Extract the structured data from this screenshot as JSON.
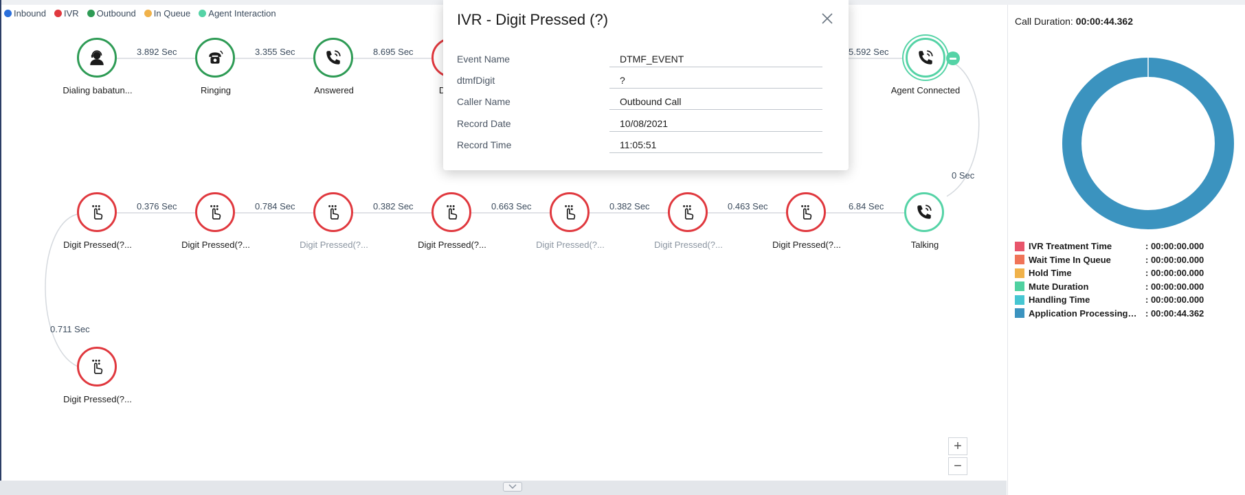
{
  "legend": [
    {
      "label": "Inbound",
      "color": "#2a6fdb"
    },
    {
      "label": "IVR",
      "color": "#e0383e"
    },
    {
      "label": "Outbound",
      "color": "#2e9b55"
    },
    {
      "label": "In Queue",
      "color": "#f0b24a"
    },
    {
      "label": "Agent Interaction",
      "color": "#55d3a6"
    }
  ],
  "flow": {
    "nodes": [
      {
        "label": "Dialing babatun...",
        "icon": "agent-headset-icon",
        "color": "green"
      },
      {
        "label": "Ringing",
        "icon": "ringing-phone-icon",
        "color": "green"
      },
      {
        "label": "Answered",
        "icon": "phone-call-icon",
        "color": "green"
      },
      {
        "label": "Digit P",
        "icon": "digit-pressed-icon",
        "color": "red"
      },
      {
        "label": "Agent Connected",
        "icon": "phone-call-icon",
        "color": "teal"
      },
      {
        "label": "Digit Pressed(?...",
        "icon": "digit-pressed-icon",
        "color": "red"
      },
      {
        "label": "Digit Pressed(?...",
        "icon": "digit-pressed-icon",
        "color": "red"
      },
      {
        "label": "Digit Pressed(?...",
        "icon": "digit-pressed-icon",
        "color": "red",
        "muted": true
      },
      {
        "label": "Digit Pressed(?...",
        "icon": "digit-pressed-icon",
        "color": "red"
      },
      {
        "label": "Digit Pressed(?...",
        "icon": "digit-pressed-icon",
        "color": "red",
        "muted": true
      },
      {
        "label": "Digit Pressed(?...",
        "icon": "digit-pressed-icon",
        "color": "red",
        "muted": true
      },
      {
        "label": "Digit Pressed(?...",
        "icon": "digit-pressed-icon",
        "color": "red"
      },
      {
        "label": "Talking",
        "icon": "phone-call-icon",
        "color": "teal"
      },
      {
        "label": "Digit Pressed(?...",
        "icon": "digit-pressed-icon",
        "color": "red"
      }
    ],
    "durations": [
      "3.892 Sec",
      "3.355 Sec",
      "8.695 Sec",
      "5.592 Sec",
      "0 Sec",
      "0.376 Sec",
      "0.784 Sec",
      "0.382 Sec",
      "0.663 Sec",
      "0.382 Sec",
      "0.463 Sec",
      "6.84 Sec",
      "0.711 Sec"
    ]
  },
  "zoom": {
    "in_label": "+",
    "out_label": "−"
  },
  "panel": {
    "call_duration_label": "Call Duration:",
    "call_duration_value": "00:00:44.362",
    "breakdown": [
      {
        "label": "IVR Treatment Time",
        "value": ": 00:00:00.000",
        "color": "#e8556b"
      },
      {
        "label": "Wait Time In Queue",
        "value": ": 00:00:00.000",
        "color": "#f07458"
      },
      {
        "label": "Hold Time",
        "value": ": 00:00:00.000",
        "color": "#f0b24a"
      },
      {
        "label": "Mute Duration",
        "value": ": 00:00:00.000",
        "color": "#4fd1a0"
      },
      {
        "label": "Handling Time",
        "value": ": 00:00:00.000",
        "color": "#46c6d2"
      },
      {
        "label": "Application Processing Ti...",
        "value": ": 00:00:44.362",
        "color": "#3b93bf"
      }
    ],
    "donut_color": "#3b93bf"
  },
  "popup": {
    "title": "IVR - Digit Pressed (?)",
    "fields": [
      {
        "key": "Event Name",
        "value": "DTMF_EVENT"
      },
      {
        "key": "dtmfDigit",
        "value": "?"
      },
      {
        "key": "Caller Name",
        "value": "Outbound Call"
      },
      {
        "key": "Record Date",
        "value": "10/08/2021"
      },
      {
        "key": "Record Time",
        "value": "11:05:51"
      }
    ]
  }
}
